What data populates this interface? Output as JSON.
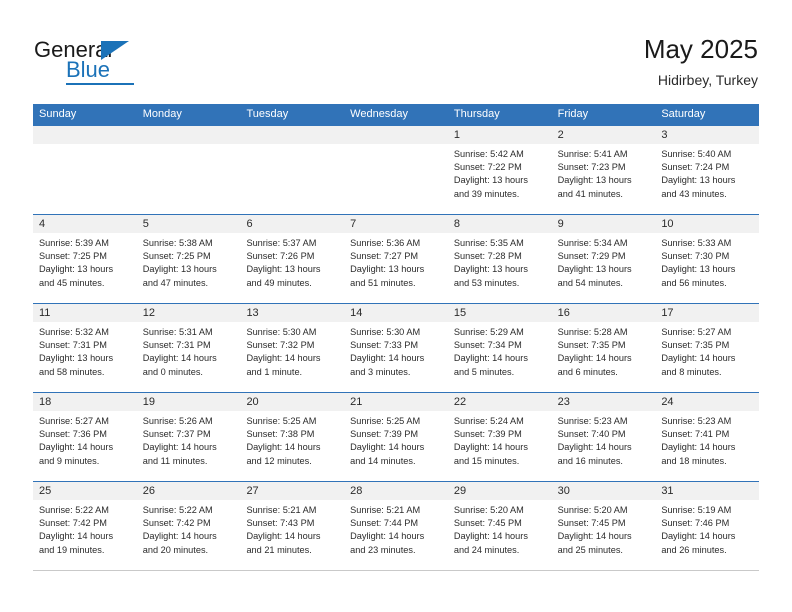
{
  "brand": {
    "name_top": "General",
    "name_bottom": "Blue",
    "triangle_color": "#1b72b8",
    "accent_color": "#1b72b8"
  },
  "header": {
    "title": "May 2025",
    "subtitle": "Hidirbey, Turkey"
  },
  "theme": {
    "header_blue": "#3173b8",
    "daynum_band": "#f1f1f1",
    "text": "#2b2b2b"
  },
  "calendar": {
    "weekday_headers": [
      "Sunday",
      "Monday",
      "Tuesday",
      "Wednesday",
      "Thursday",
      "Friday",
      "Saturday"
    ],
    "weeks": [
      [
        {
          "day": "",
          "sunrise": "",
          "sunset": "",
          "daylight_1": "",
          "daylight_2": ""
        },
        {
          "day": "",
          "sunrise": "",
          "sunset": "",
          "daylight_1": "",
          "daylight_2": ""
        },
        {
          "day": "",
          "sunrise": "",
          "sunset": "",
          "daylight_1": "",
          "daylight_2": ""
        },
        {
          "day": "",
          "sunrise": "",
          "sunset": "",
          "daylight_1": "",
          "daylight_2": ""
        },
        {
          "day": "1",
          "sunrise": "Sunrise: 5:42 AM",
          "sunset": "Sunset: 7:22 PM",
          "daylight_1": "Daylight: 13 hours",
          "daylight_2": "and 39 minutes."
        },
        {
          "day": "2",
          "sunrise": "Sunrise: 5:41 AM",
          "sunset": "Sunset: 7:23 PM",
          "daylight_1": "Daylight: 13 hours",
          "daylight_2": "and 41 minutes."
        },
        {
          "day": "3",
          "sunrise": "Sunrise: 5:40 AM",
          "sunset": "Sunset: 7:24 PM",
          "daylight_1": "Daylight: 13 hours",
          "daylight_2": "and 43 minutes."
        }
      ],
      [
        {
          "day": "4",
          "sunrise": "Sunrise: 5:39 AM",
          "sunset": "Sunset: 7:25 PM",
          "daylight_1": "Daylight: 13 hours",
          "daylight_2": "and 45 minutes."
        },
        {
          "day": "5",
          "sunrise": "Sunrise: 5:38 AM",
          "sunset": "Sunset: 7:25 PM",
          "daylight_1": "Daylight: 13 hours",
          "daylight_2": "and 47 minutes."
        },
        {
          "day": "6",
          "sunrise": "Sunrise: 5:37 AM",
          "sunset": "Sunset: 7:26 PM",
          "daylight_1": "Daylight: 13 hours",
          "daylight_2": "and 49 minutes."
        },
        {
          "day": "7",
          "sunrise": "Sunrise: 5:36 AM",
          "sunset": "Sunset: 7:27 PM",
          "daylight_1": "Daylight: 13 hours",
          "daylight_2": "and 51 minutes."
        },
        {
          "day": "8",
          "sunrise": "Sunrise: 5:35 AM",
          "sunset": "Sunset: 7:28 PM",
          "daylight_1": "Daylight: 13 hours",
          "daylight_2": "and 53 minutes."
        },
        {
          "day": "9",
          "sunrise": "Sunrise: 5:34 AM",
          "sunset": "Sunset: 7:29 PM",
          "daylight_1": "Daylight: 13 hours",
          "daylight_2": "and 54 minutes."
        },
        {
          "day": "10",
          "sunrise": "Sunrise: 5:33 AM",
          "sunset": "Sunset: 7:30 PM",
          "daylight_1": "Daylight: 13 hours",
          "daylight_2": "and 56 minutes."
        }
      ],
      [
        {
          "day": "11",
          "sunrise": "Sunrise: 5:32 AM",
          "sunset": "Sunset: 7:31 PM",
          "daylight_1": "Daylight: 13 hours",
          "daylight_2": "and 58 minutes."
        },
        {
          "day": "12",
          "sunrise": "Sunrise: 5:31 AM",
          "sunset": "Sunset: 7:31 PM",
          "daylight_1": "Daylight: 14 hours",
          "daylight_2": "and 0 minutes."
        },
        {
          "day": "13",
          "sunrise": "Sunrise: 5:30 AM",
          "sunset": "Sunset: 7:32 PM",
          "daylight_1": "Daylight: 14 hours",
          "daylight_2": "and 1 minute."
        },
        {
          "day": "14",
          "sunrise": "Sunrise: 5:30 AM",
          "sunset": "Sunset: 7:33 PM",
          "daylight_1": "Daylight: 14 hours",
          "daylight_2": "and 3 minutes."
        },
        {
          "day": "15",
          "sunrise": "Sunrise: 5:29 AM",
          "sunset": "Sunset: 7:34 PM",
          "daylight_1": "Daylight: 14 hours",
          "daylight_2": "and 5 minutes."
        },
        {
          "day": "16",
          "sunrise": "Sunrise: 5:28 AM",
          "sunset": "Sunset: 7:35 PM",
          "daylight_1": "Daylight: 14 hours",
          "daylight_2": "and 6 minutes."
        },
        {
          "day": "17",
          "sunrise": "Sunrise: 5:27 AM",
          "sunset": "Sunset: 7:35 PM",
          "daylight_1": "Daylight: 14 hours",
          "daylight_2": "and 8 minutes."
        }
      ],
      [
        {
          "day": "18",
          "sunrise": "Sunrise: 5:27 AM",
          "sunset": "Sunset: 7:36 PM",
          "daylight_1": "Daylight: 14 hours",
          "daylight_2": "and 9 minutes."
        },
        {
          "day": "19",
          "sunrise": "Sunrise: 5:26 AM",
          "sunset": "Sunset: 7:37 PM",
          "daylight_1": "Daylight: 14 hours",
          "daylight_2": "and 11 minutes."
        },
        {
          "day": "20",
          "sunrise": "Sunrise: 5:25 AM",
          "sunset": "Sunset: 7:38 PM",
          "daylight_1": "Daylight: 14 hours",
          "daylight_2": "and 12 minutes."
        },
        {
          "day": "21",
          "sunrise": "Sunrise: 5:25 AM",
          "sunset": "Sunset: 7:39 PM",
          "daylight_1": "Daylight: 14 hours",
          "daylight_2": "and 14 minutes."
        },
        {
          "day": "22",
          "sunrise": "Sunrise: 5:24 AM",
          "sunset": "Sunset: 7:39 PM",
          "daylight_1": "Daylight: 14 hours",
          "daylight_2": "and 15 minutes."
        },
        {
          "day": "23",
          "sunrise": "Sunrise: 5:23 AM",
          "sunset": "Sunset: 7:40 PM",
          "daylight_1": "Daylight: 14 hours",
          "daylight_2": "and 16 minutes."
        },
        {
          "day": "24",
          "sunrise": "Sunrise: 5:23 AM",
          "sunset": "Sunset: 7:41 PM",
          "daylight_1": "Daylight: 14 hours",
          "daylight_2": "and 18 minutes."
        }
      ],
      [
        {
          "day": "25",
          "sunrise": "Sunrise: 5:22 AM",
          "sunset": "Sunset: 7:42 PM",
          "daylight_1": "Daylight: 14 hours",
          "daylight_2": "and 19 minutes."
        },
        {
          "day": "26",
          "sunrise": "Sunrise: 5:22 AM",
          "sunset": "Sunset: 7:42 PM",
          "daylight_1": "Daylight: 14 hours",
          "daylight_2": "and 20 minutes."
        },
        {
          "day": "27",
          "sunrise": "Sunrise: 5:21 AM",
          "sunset": "Sunset: 7:43 PM",
          "daylight_1": "Daylight: 14 hours",
          "daylight_2": "and 21 minutes."
        },
        {
          "day": "28",
          "sunrise": "Sunrise: 5:21 AM",
          "sunset": "Sunset: 7:44 PM",
          "daylight_1": "Daylight: 14 hours",
          "daylight_2": "and 23 minutes."
        },
        {
          "day": "29",
          "sunrise": "Sunrise: 5:20 AM",
          "sunset": "Sunset: 7:45 PM",
          "daylight_1": "Daylight: 14 hours",
          "daylight_2": "and 24 minutes."
        },
        {
          "day": "30",
          "sunrise": "Sunrise: 5:20 AM",
          "sunset": "Sunset: 7:45 PM",
          "daylight_1": "Daylight: 14 hours",
          "daylight_2": "and 25 minutes."
        },
        {
          "day": "31",
          "sunrise": "Sunrise: 5:19 AM",
          "sunset": "Sunset: 7:46 PM",
          "daylight_1": "Daylight: 14 hours",
          "daylight_2": "and 26 minutes."
        }
      ]
    ]
  }
}
